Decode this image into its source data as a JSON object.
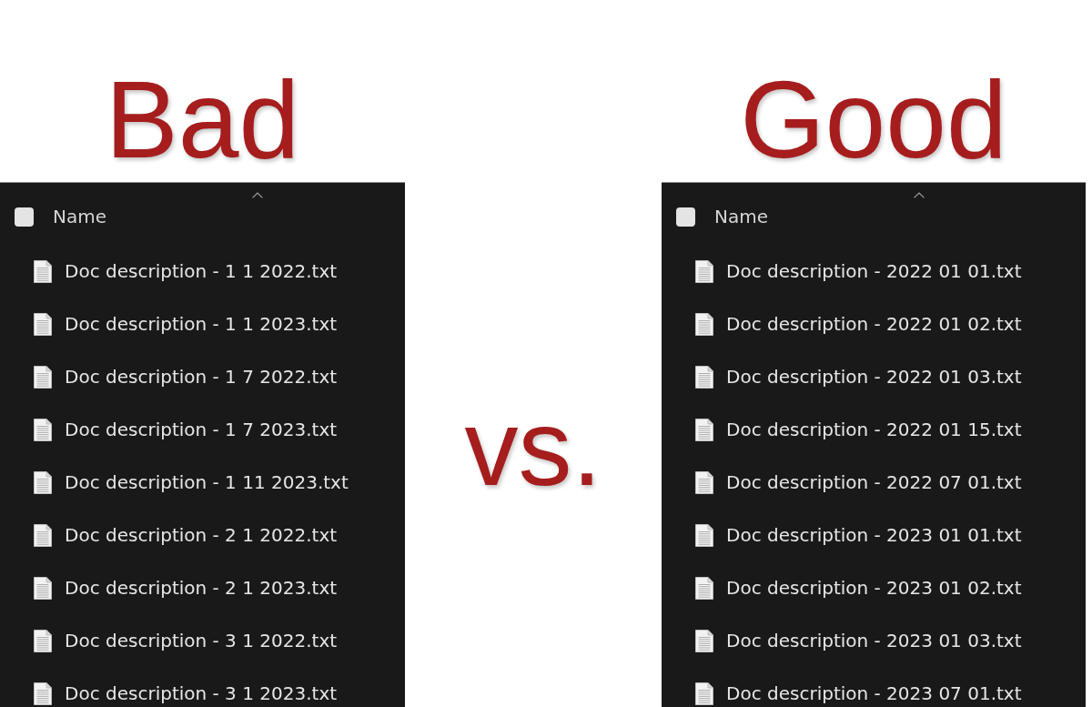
{
  "panels": [
    {
      "title": "Bad",
      "header": {
        "checked": false,
        "sorted": true,
        "label": "Name"
      },
      "files": [
        "Doc description - 1 1 2022.txt",
        "Doc description - 1 1 2023.txt",
        "Doc description - 1 7 2022.txt",
        "Doc description - 1 7 2023.txt",
        "Doc description - 1 11 2023.txt",
        "Doc description - 2 1 2022.txt",
        "Doc description - 2 1 2023.txt",
        "Doc description - 3 1 2022.txt",
        "Doc description - 3 1 2023.txt"
      ]
    },
    {
      "title": "Good",
      "header": {
        "checked": false,
        "sorted": true,
        "label": "Name"
      },
      "files": [
        "Doc description - 2022 01 01.txt",
        "Doc description - 2022 01 02.txt",
        "Doc description - 2022 01 03.txt",
        "Doc description - 2022 01 15.txt",
        "Doc description - 2022 07 01.txt",
        "Doc description - 2023 01 01.txt",
        "Doc description - 2023 01 02.txt",
        "Doc description - 2023 01 03.txt",
        "Doc description - 2023 07 01.txt"
      ]
    }
  ],
  "versus": "vs."
}
